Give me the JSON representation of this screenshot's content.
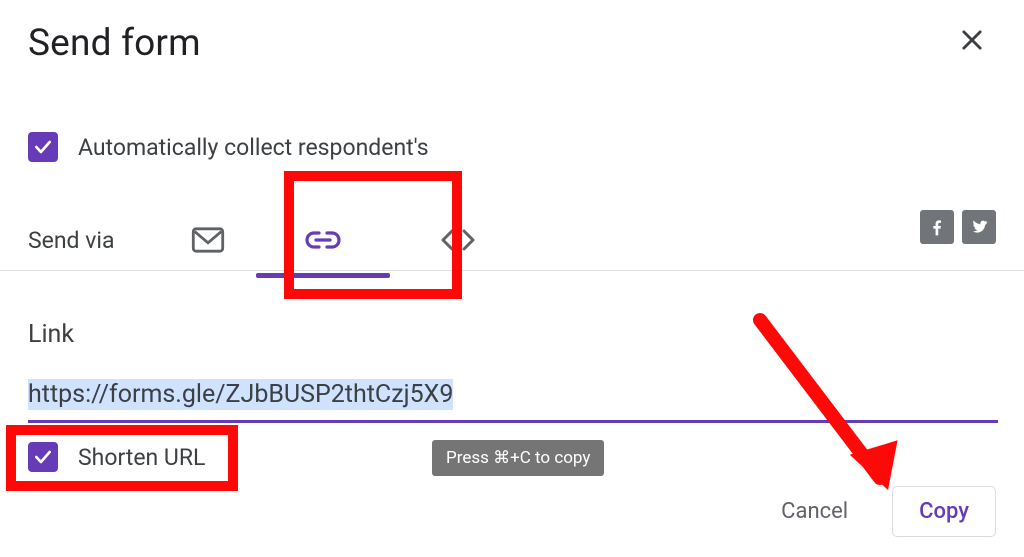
{
  "dialog": {
    "title": "Send form",
    "collect_label": "Automatically collect respondent's",
    "collect_checked": true,
    "send_via_label": "Send via",
    "tabs": {
      "email": "email",
      "link": "link",
      "embed": "embed",
      "active": "link"
    },
    "social": {
      "facebook": "facebook",
      "twitter": "twitter"
    }
  },
  "link_section": {
    "label": "Link",
    "url_value": "https://forms.gle/ZJbBUSP2thtCzj5X9",
    "shorten_label": "Shorten URL",
    "shorten_checked": true,
    "tooltip": "Press ⌘+C to copy"
  },
  "footer": {
    "cancel_label": "Cancel",
    "copy_label": "Copy"
  },
  "annotations": {
    "highlight_link_tab": true,
    "highlight_shorten": true,
    "arrow_to_copy": true
  }
}
